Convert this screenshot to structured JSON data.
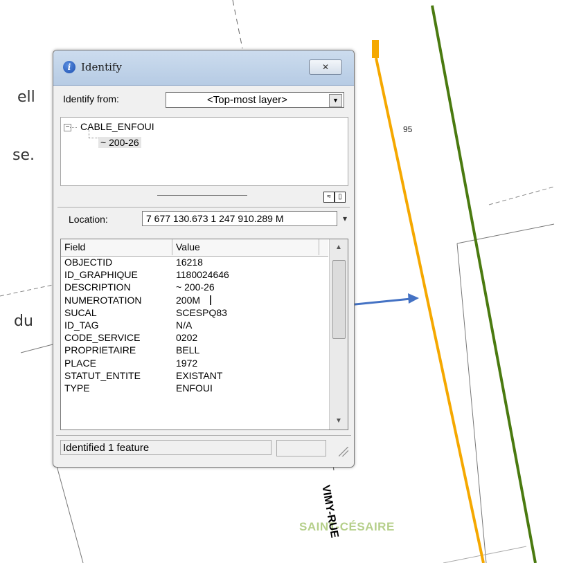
{
  "background": {
    "text_fragments": [
      "ell",
      "se.",
      "du"
    ],
    "map_labels": {
      "number": "95",
      "street": "VIMY-RUE",
      "town": "SAINT-CÉSAIRE"
    },
    "colors": {
      "orange_line": "#f5a800",
      "green_line": "#4a7a10",
      "arrow": "#4472c4",
      "town_label": "#b5cf8a"
    }
  },
  "window": {
    "title": "Identify",
    "title_icon": "info-icon",
    "close_label": "✕",
    "identify_from_label": "Identify from:",
    "identify_from_value": "<Top-most layer>",
    "tree": {
      "parent": "CABLE_ENFOUI",
      "child": "~ 200-26"
    },
    "location_label": "Location:",
    "location_value": "7 677 130.673  1 247 910.289 M",
    "grid": {
      "headers": [
        "Field",
        "Value"
      ],
      "rows": [
        {
          "field": "OBJECTID",
          "value": "16218"
        },
        {
          "field": "ID_GRAPHIQUE",
          "value": "1180024646"
        },
        {
          "field": "DESCRIPTION",
          "value": "~ 200-26"
        },
        {
          "field": "NUMEROTATION",
          "value": "200M"
        },
        {
          "field": "SUCAL",
          "value": "SCESPQ83"
        },
        {
          "field": "ID_TAG",
          "value": "N/A"
        },
        {
          "field": "CODE_SERVICE",
          "value": "0202"
        },
        {
          "field": "PROPRIETAIRE",
          "value": "BELL"
        },
        {
          "field": "PLACE",
          "value": "1972"
        },
        {
          "field": "STATUT_ENTITE",
          "value": "EXISTANT"
        },
        {
          "field": "TYPE",
          "value": "ENFOUI"
        }
      ]
    },
    "status": "Identified 1 feature"
  }
}
